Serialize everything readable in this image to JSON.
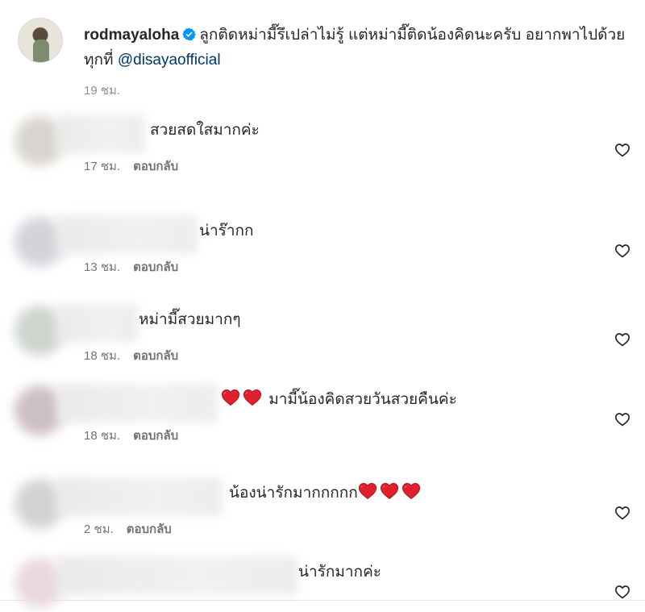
{
  "post": {
    "username": "rodmayaloha",
    "caption": "ลูกติดหม่ามี๊รึเปล่าไม่รู้ แต่หม่ามี๊ติดน้องคิดนะครับ อยากพาไปด้วยทุกที่",
    "mention": "@disayaofficial",
    "time": "19 ชม.",
    "verified": true
  },
  "reply_label": "ตอบกลับ",
  "comments": [
    {
      "text": "สวยสดใสมากค่ะ",
      "time": "17 ชม.",
      "heart_count": 0
    },
    {
      "text": "น่าร๊ากก",
      "time": "13 ชม.",
      "heart_count": 0
    },
    {
      "text": "หม่ามี๊สวยมากๆ",
      "time": "18 ชม.",
      "heart_count": 0
    },
    {
      "text": "มามี๊น้องคิดสวยวันสวยคืนค่ะ",
      "time": "18 ชม.",
      "heart_count": 2
    },
    {
      "text": "น้องน่ารักมากกกกก",
      "time": "2 ชม.",
      "heart_count": 3
    },
    {
      "text": "น่ารักมากค่ะ",
      "time": "",
      "heart_count": 0
    }
  ],
  "icons": {
    "like": "heart-outline-icon",
    "verified": "verified-badge-icon",
    "emoji": "red-heart-emoji"
  },
  "colors": {
    "mention": "#00376b",
    "verified": "#0095f6",
    "heart_emoji": "#e0202c"
  }
}
